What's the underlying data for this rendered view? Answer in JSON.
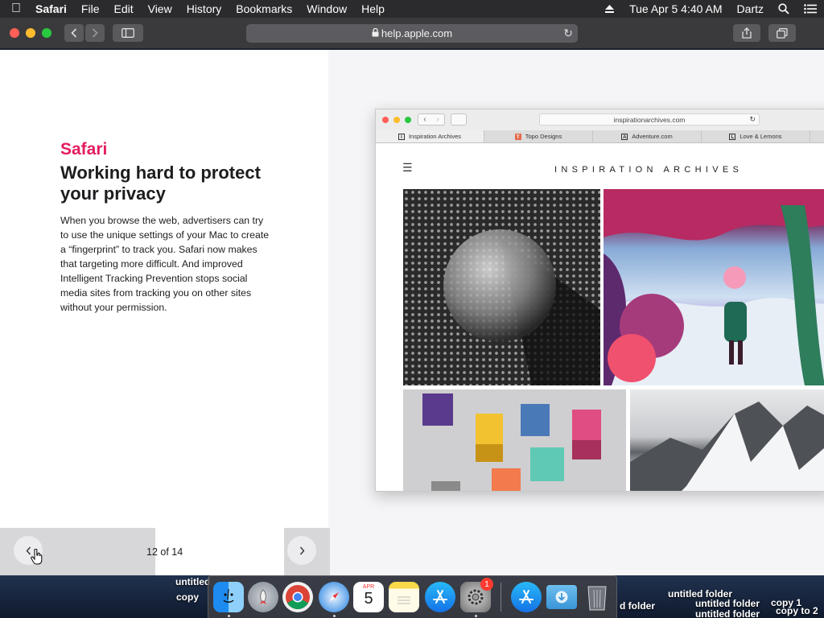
{
  "menubar": {
    "app_name": "Safari",
    "items": [
      "File",
      "Edit",
      "View",
      "History",
      "Bookmarks",
      "Window",
      "Help"
    ],
    "clock": "Tue Apr 5  4:40 AM",
    "user": "Dartz"
  },
  "toolbar": {
    "url": "help.apple.com"
  },
  "article": {
    "eyebrow": "Safari",
    "headline": "Working hard to protect your privacy",
    "body": "When you browse the web, advertisers can try to use the unique settings of your Mac to create a “fingerprint” to track you. Safari now makes that targeting more difficult. And improved Intelligent Tracking Prevention stops social media sites from tracking you on other sites without your permission."
  },
  "pager": {
    "counter": "12 of 14"
  },
  "preview": {
    "url": "inspirationarchives.com",
    "tabs": [
      {
        "label": "Inspiration Archives",
        "favicon": "I"
      },
      {
        "label": "Topo Designs",
        "favicon": "T"
      },
      {
        "label": "Adventure.com",
        "favicon": "A"
      },
      {
        "label": "Love & Lemons",
        "favicon": "L"
      }
    ],
    "site_logo": "INSPIRATION ARCHIVES"
  },
  "dock": {
    "apps": [
      "Finder",
      "Launchpad",
      "Google Chrome",
      "Safari",
      "Calendar",
      "Notes",
      "App Store",
      "System Preferences",
      "App Store",
      "Downloads",
      "Trash"
    ],
    "calendar": {
      "month": "APR",
      "day": "5"
    },
    "system_preferences_badge": "1"
  },
  "desktop": {
    "folder_labels": [
      "untitled",
      "copy",
      "untitled folder",
      "copy 1",
      "untitled folder",
      "copy to 2",
      "untitled folder",
      "d folder"
    ]
  },
  "colors": {
    "accent": "#e31c5f",
    "menubar": "#2b2b2d",
    "toolbar": "#3a3a3c"
  }
}
